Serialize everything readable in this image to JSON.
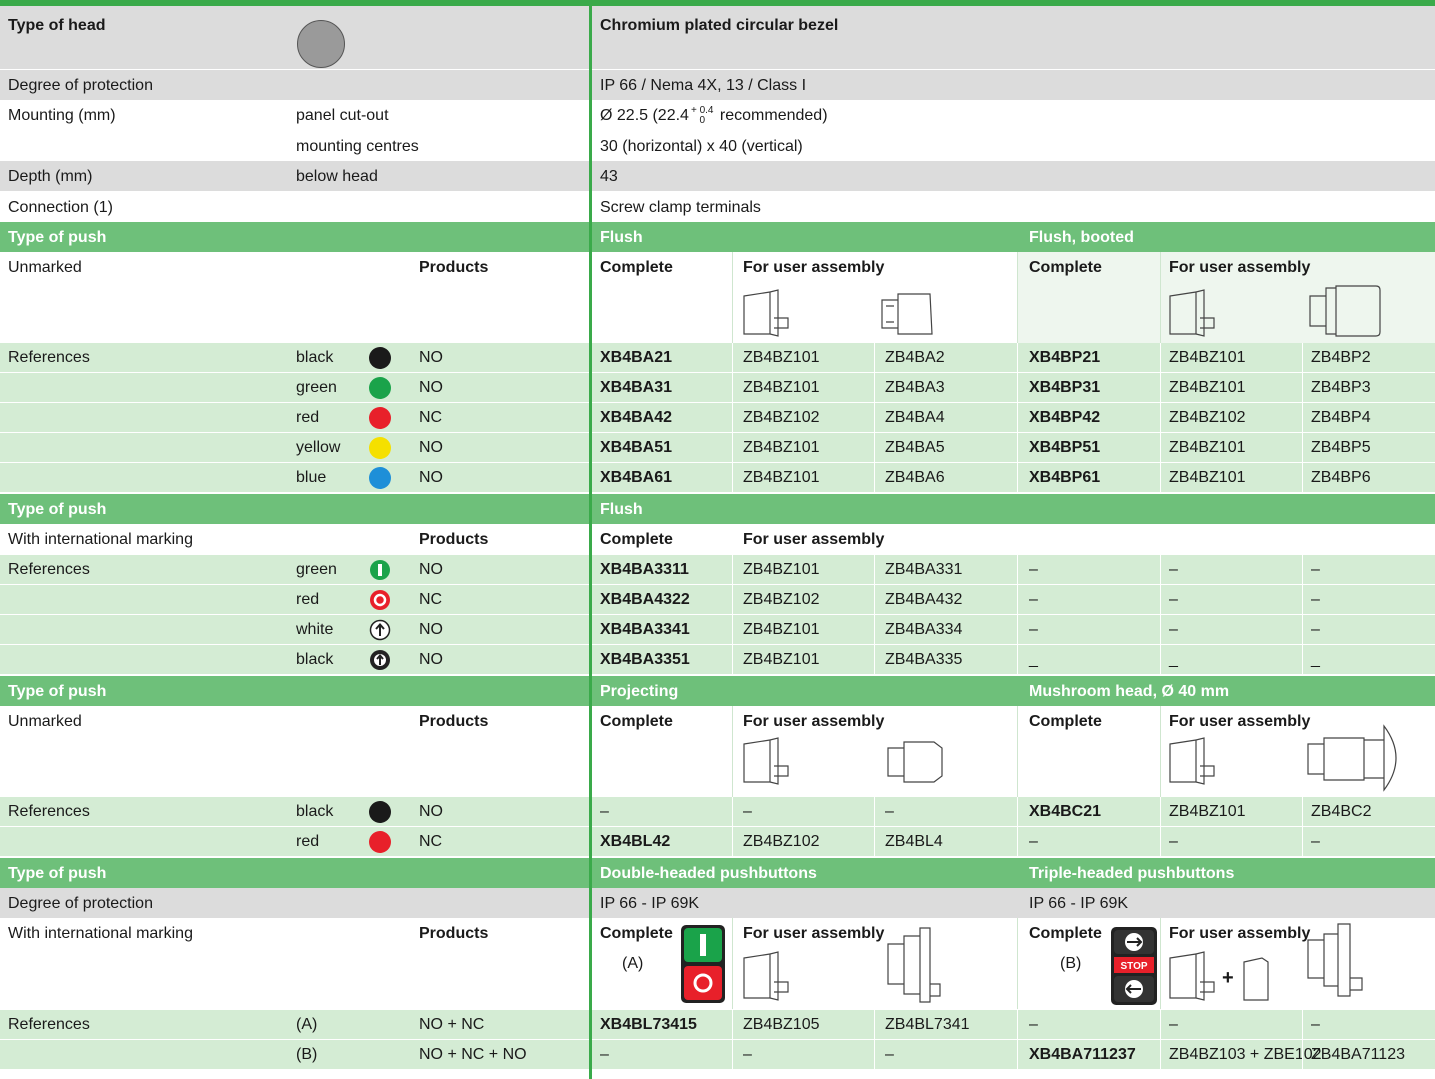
{
  "head": {
    "label": "Type of head",
    "value": "Chromium plated circular bezel"
  },
  "general": [
    {
      "label": "Degree of protection",
      "sub": "",
      "value": "IP 66 / Nema 4X, 13 / Class I"
    },
    {
      "label": "Mounting (mm)",
      "sub": "panel cut-out",
      "value_pre": "Ø 22.5 (22.4",
      "value_sup": "+ 0.4",
      "value_sub": "0",
      "value_post": " recommended)"
    },
    {
      "label": "",
      "sub": "mounting centres",
      "value": "30 (horizontal) x 40 (vertical)"
    },
    {
      "label": "Depth (mm)",
      "sub": "below head",
      "value": "43"
    },
    {
      "label": "Connection (1)",
      "sub": "",
      "value": "Screw clamp terminals"
    }
  ],
  "common": {
    "type_of_push": "Type of push",
    "products": "Products",
    "complete": "Complete",
    "for_user_assembly": "For user assembly",
    "references": "References",
    "dash": "–"
  },
  "sec1": {
    "left": "Unmarked",
    "col1": "Flush",
    "col2": "Flush, booted",
    "rows": [
      {
        "color": "black",
        "dot": "#1a1a1a",
        "contact": "NO",
        "a": "XB4BA21",
        "b": "ZB4BZ101",
        "c": "ZB4BA2",
        "d": "XB4BP21",
        "e": "ZB4BZ101",
        "f": "ZB4BP2"
      },
      {
        "color": "green",
        "dot": "#1aa34a",
        "contact": "NO",
        "a": "XB4BA31",
        "b": "ZB4BZ101",
        "c": "ZB4BA3",
        "d": "XB4BP31",
        "e": "ZB4BZ101",
        "f": "ZB4BP3"
      },
      {
        "color": "red",
        "dot": "#e8202a",
        "contact": "NC",
        "a": "XB4BA42",
        "b": "ZB4BZ102",
        "c": "ZB4BA4",
        "d": "XB4BP42",
        "e": "ZB4BZ102",
        "f": "ZB4BP4"
      },
      {
        "color": "yellow",
        "dot": "#f5e000",
        "contact": "NO",
        "a": "XB4BA51",
        "b": "ZB4BZ101",
        "c": "ZB4BA5",
        "d": "XB4BP51",
        "e": "ZB4BZ101",
        "f": "ZB4BP5"
      },
      {
        "color": "blue",
        "dot": "#1e8fd8",
        "contact": "NO",
        "a": "XB4BA61",
        "b": "ZB4BZ101",
        "c": "ZB4BA6",
        "d": "XB4BP61",
        "e": "ZB4BZ101",
        "f": "ZB4BP6"
      }
    ]
  },
  "sec2": {
    "left": "With international marking",
    "col1": "Flush",
    "rows": [
      {
        "color": "green",
        "icon": "green-i-icon",
        "contact": "NO",
        "a": "XB4BA3311",
        "b": "ZB4BZ101",
        "c": "ZB4BA331",
        "d": "–",
        "e": "–",
        "f": "–"
      },
      {
        "color": "red",
        "icon": "red-o-icon",
        "contact": "NC",
        "a": "XB4BA4322",
        "b": "ZB4BZ102",
        "c": "ZB4BA432",
        "d": "–",
        "e": "–",
        "f": "–"
      },
      {
        "color": "white",
        "icon": "white-arrow-icon",
        "contact": "NO",
        "a": "XB4BA3341",
        "b": "ZB4BZ101",
        "c": "ZB4BA334",
        "d": "–",
        "e": "–",
        "f": "–"
      },
      {
        "color": "black",
        "icon": "black-arrow-icon",
        "contact": "NO",
        "a": "XB4BA3351",
        "b": "ZB4BZ101",
        "c": "ZB4BA335",
        "d": "_",
        "e": "_",
        "f": "_"
      }
    ]
  },
  "sec3": {
    "left": "Unmarked",
    "col1": "Projecting",
    "col2": "Mushroom head, Ø 40 mm",
    "rows": [
      {
        "color": "black",
        "dot": "#1a1a1a",
        "contact": "NO",
        "a": "–",
        "b": "–",
        "c": "–",
        "d": "XB4BC21",
        "e": "ZB4BZ101",
        "f": "ZB4BC2"
      },
      {
        "color": "red",
        "dot": "#e8202a",
        "contact": "NC",
        "a": "XB4BL42",
        "b": "ZB4BZ102",
        "c": "ZB4BL4",
        "d": "–",
        "e": "–",
        "f": "–"
      }
    ]
  },
  "sec4": {
    "col1": "Double-headed pushbuttons",
    "col2": "Triple-headed pushbuttons",
    "protection_label": "Degree of protection",
    "protection1": "IP 66 - IP 69K",
    "protection2": "IP 66 - IP 69K",
    "left": "With international marking",
    "markA": "(A)",
    "markB": "(B)",
    "stop": "STOP",
    "plus": "+",
    "rows": [
      {
        "mark": "(A)",
        "contact": "NO + NC",
        "a": "XB4BL73415",
        "b": "ZB4BZ105",
        "c": "ZB4BL7341",
        "d": "–",
        "e": "–",
        "f": "–"
      },
      {
        "mark": "(B)",
        "contact": "NO + NC + NO",
        "a": "–",
        "b": "–",
        "c": "–",
        "d": "XB4BA711237",
        "e": "ZB4BZ103 + ZBE102",
        "f": "ZB4BA71123"
      }
    ]
  },
  "colors": {
    "header_green": "#6ec07a",
    "divider_green": "#3aaa4a",
    "light_green": "#d4ecd4",
    "grey": "#dcdcdc"
  }
}
